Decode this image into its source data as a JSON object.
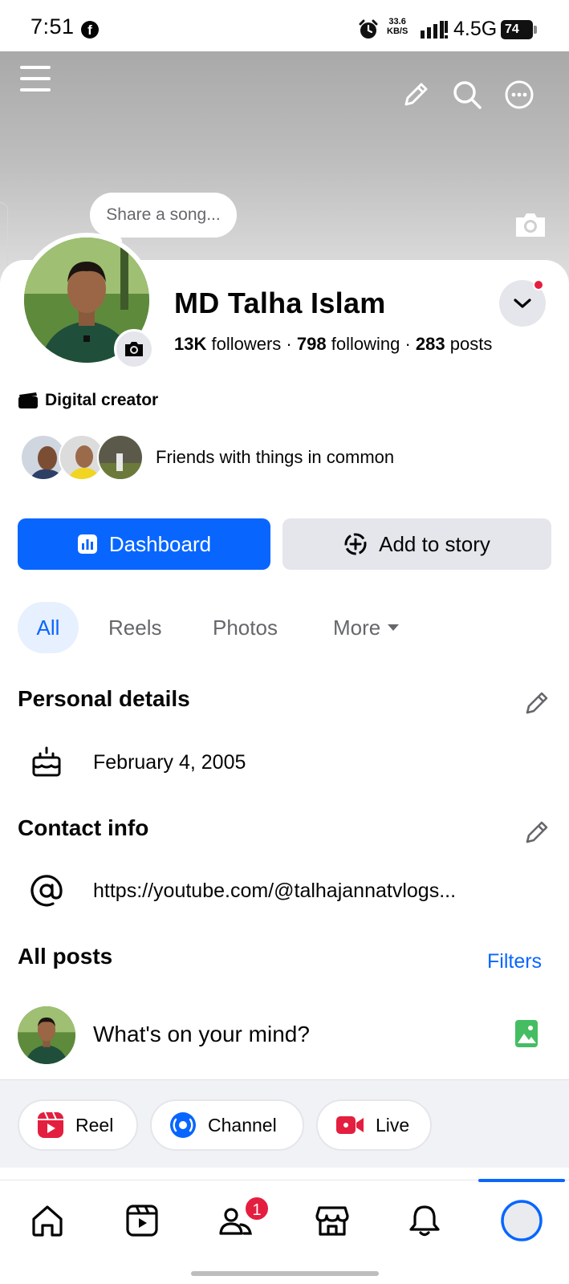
{
  "status_bar": {
    "time": "7:51",
    "fb_glyph": "f",
    "speed_value": "33.6",
    "speed_unit": "KB/S",
    "network": "4.5G",
    "battery": "74"
  },
  "cover": {
    "song_prompt": "Share a song..."
  },
  "profile": {
    "name": "MD Talha Islam",
    "followers_count": "13K",
    "followers_label": "followers",
    "following_count": "798",
    "following_label": "following",
    "posts_count": "283",
    "posts_label": "posts",
    "separator": "·",
    "category": "Digital creator",
    "friends_text": "Friends with things in common"
  },
  "buttons": {
    "dashboard": "Dashboard",
    "add_story": "Add to story"
  },
  "tabs": {
    "all": "All",
    "reels": "Reels",
    "photos": "Photos",
    "more": "More"
  },
  "personal_details": {
    "title": "Personal details",
    "birthday": "February 4, 2005"
  },
  "contact_info": {
    "title": "Contact info",
    "link": "https://youtube.com/@talhajannatvlogs..."
  },
  "posts": {
    "title": "All posts",
    "filters": "Filters",
    "composer_placeholder": "What's on your mind?"
  },
  "quick_actions": {
    "reel": "Reel",
    "channel": "Channel",
    "live": "Live"
  },
  "nav": {
    "friends_badge": "1"
  },
  "colors": {
    "accent": "#0866ff",
    "badge": "#e41e3f",
    "reel": "#e41e3f",
    "live": "#e41e3f",
    "photo": "#45bd62"
  },
  "icons": [
    "menu-icon",
    "pencil-icon",
    "search-icon",
    "more-icon",
    "camera-icon",
    "chevron-down-icon",
    "clapperboard-icon",
    "dashboard-icon",
    "add-story-icon",
    "cake-icon",
    "at-icon",
    "photo-icon",
    "reel-icon",
    "channel-icon",
    "live-icon",
    "home-icon",
    "video-icon",
    "friends-icon",
    "marketplace-icon",
    "bell-icon",
    "profile-icon"
  ]
}
